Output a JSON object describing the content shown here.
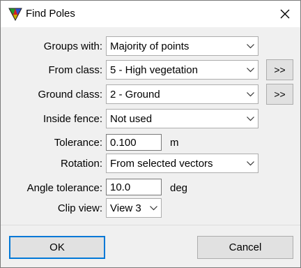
{
  "window": {
    "title": "Find Poles",
    "app_icon": "colored-triangle-app-icon",
    "close_icon": "close-icon"
  },
  "form": {
    "groups_with": {
      "label": "Groups with:",
      "value": "Majority of points"
    },
    "from_class": {
      "label": "From class:",
      "value": "5 - High vegetation",
      "browse_label": ">>"
    },
    "ground_class": {
      "label": "Ground class:",
      "value": "2 - Ground",
      "browse_label": ">>"
    },
    "inside_fence": {
      "label": "Inside fence:",
      "value": "Not used"
    },
    "tolerance": {
      "label": "Tolerance:",
      "value": "0.100",
      "unit": "m"
    },
    "rotation": {
      "label": "Rotation:",
      "value": "From selected vectors"
    },
    "angle_tolerance": {
      "label": "Angle tolerance:",
      "value": "10.0",
      "unit": "deg"
    },
    "clip_view": {
      "label": "Clip view:",
      "value": "View 3"
    }
  },
  "buttons": {
    "ok": "OK",
    "cancel": "Cancel"
  }
}
